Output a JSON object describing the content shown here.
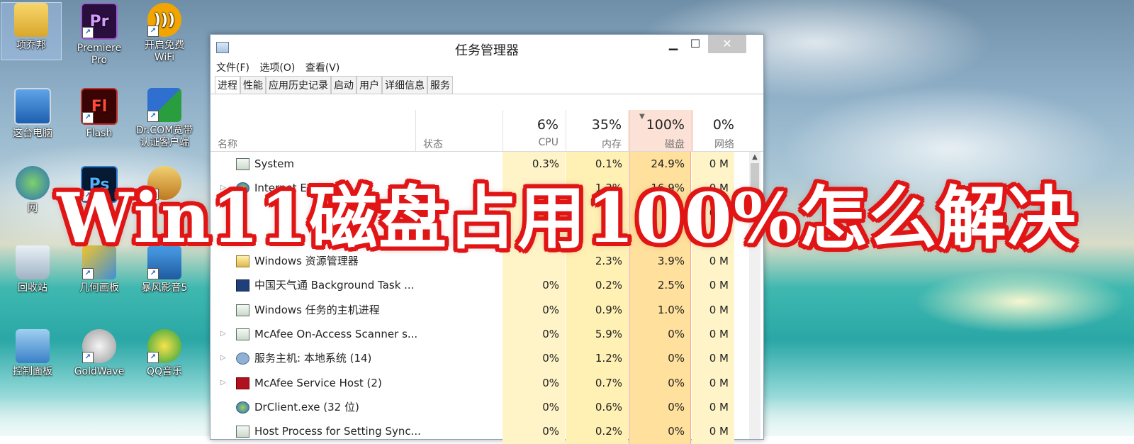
{
  "banner": {
    "text": "Win11磁盘占用100%怎么解决"
  },
  "desktop": {
    "icons": [
      {
        "label": "项乔邦",
        "icon": "user-folder-icon"
      },
      {
        "label": "Premiere Pro",
        "icon": "premiere-icon",
        "glyph": "Pr"
      },
      {
        "label": "开启免费WiFi",
        "icon": "wifi-icon"
      },
      {
        "label": "这台电脑",
        "icon": "computer-icon"
      },
      {
        "label": "Flash",
        "icon": "flash-icon",
        "glyph": "Fl"
      },
      {
        "label": "Dr.COM宽带认证客户端",
        "icon": "drcom-icon"
      },
      {
        "label": "网",
        "icon": "network-icon"
      },
      {
        "label": "",
        "icon": "photoshop-icon",
        "glyph": "Ps"
      },
      {
        "label": "",
        "icon": "cartoon-app-icon"
      },
      {
        "label": "回收站",
        "icon": "recycle-bin-icon"
      },
      {
        "label": "几何画板",
        "icon": "geometry-sketchpad-icon"
      },
      {
        "label": "暴风影音5",
        "icon": "baofeng-icon"
      },
      {
        "label": "控制面板",
        "icon": "control-panel-icon"
      },
      {
        "label": "GoldWave",
        "icon": "goldwave-icon"
      },
      {
        "label": "QQ音乐",
        "icon": "qqmusic-icon"
      }
    ]
  },
  "taskmanager": {
    "title": "任务管理器",
    "menu": [
      "文件(F)",
      "选项(O)",
      "查看(V)"
    ],
    "tabs": [
      "进程",
      "性能",
      "应用历史记录",
      "启动",
      "用户",
      "详细信息",
      "服务"
    ],
    "columns": {
      "name": "名称",
      "status": "状态",
      "cpu": {
        "pct": "6%",
        "label": "CPU"
      },
      "memory": {
        "pct": "35%",
        "label": "内存"
      },
      "disk": {
        "pct": "100%",
        "label": "磁盘"
      },
      "network": {
        "pct": "0%",
        "label": "网络"
      }
    },
    "rows": [
      {
        "name": "System",
        "cpu": "0.3%",
        "mem": "0.1%",
        "disk": "24.9%",
        "net": "0 M"
      },
      {
        "name": "Internet Explorer",
        "cpu": "",
        "mem": "1.3%",
        "disk": "16.9%",
        "net": "0 M"
      },
      {
        "name": "",
        "cpu": "",
        "mem": "",
        "disk": "",
        "net": "0 M"
      },
      {
        "name": "",
        "cpu": "",
        "mem": "",
        "disk": "",
        "net": "0 M"
      },
      {
        "name": "Windows 资源管理器",
        "cpu": "",
        "mem": "2.3%",
        "disk": "3.9%",
        "net": "0 M"
      },
      {
        "name": "中国天气通 Background Task ...",
        "cpu": "0%",
        "mem": "0.2%",
        "disk": "2.5%",
        "net": "0 M"
      },
      {
        "name": "Windows 任务的主机进程",
        "cpu": "0%",
        "mem": "0.9%",
        "disk": "1.0%",
        "net": "0 M"
      },
      {
        "name": "McAfee On-Access Scanner s...",
        "cpu": "0%",
        "mem": "5.9%",
        "disk": "0%",
        "net": "0 M"
      },
      {
        "name": "服务主机: 本地系统 (14)",
        "cpu": "0%",
        "mem": "1.2%",
        "disk": "0%",
        "net": "0 M"
      },
      {
        "name": "McAfee Service Host (2)",
        "cpu": "0%",
        "mem": "0.7%",
        "disk": "0%",
        "net": "0 M"
      },
      {
        "name": "DrClient.exe (32 位)",
        "cpu": "0%",
        "mem": "0.6%",
        "disk": "0%",
        "net": "0 M"
      },
      {
        "name": "Host Process for Setting Sync...",
        "cpu": "0%",
        "mem": "0.2%",
        "disk": "0%",
        "net": "0 M"
      }
    ]
  }
}
